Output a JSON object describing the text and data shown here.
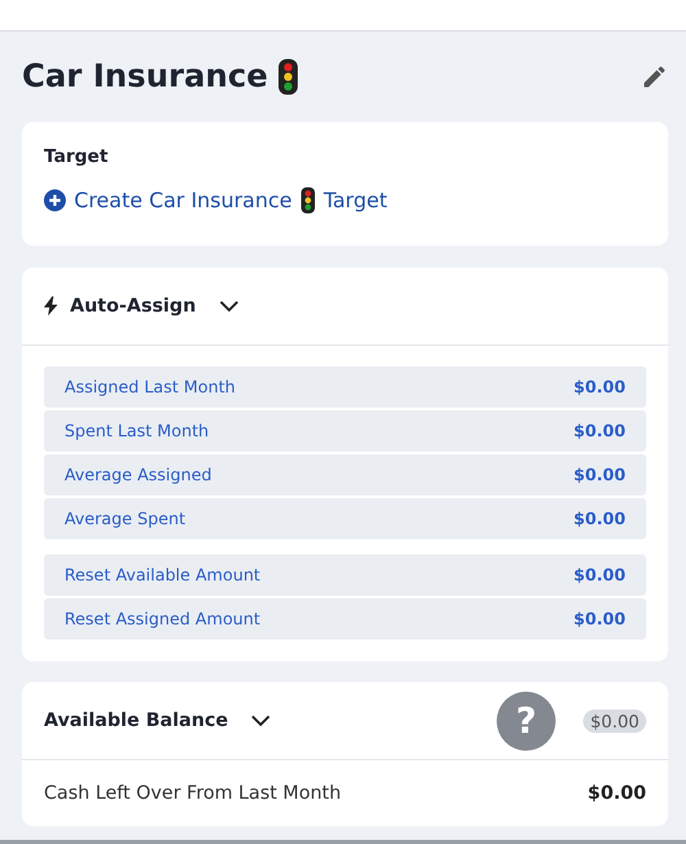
{
  "title": "Car Insurance",
  "target": {
    "heading": "Target",
    "link_before": "Create Car Insurance",
    "link_after": "Target"
  },
  "auto_assign": {
    "label": "Auto-Assign",
    "expanded": true,
    "groups": [
      [
        {
          "label": "Assigned Last Month",
          "amount": "$0.00"
        },
        {
          "label": "Spent Last Month",
          "amount": "$0.00"
        },
        {
          "label": "Average Assigned",
          "amount": "$0.00"
        },
        {
          "label": "Average Spent",
          "amount": "$0.00"
        }
      ],
      [
        {
          "label": "Reset Available Amount",
          "amount": "$0.00"
        },
        {
          "label": "Reset Assigned Amount",
          "amount": "$0.00"
        }
      ]
    ]
  },
  "available_balance": {
    "label": "Available Balance",
    "expanded": true,
    "amount": "$0.00",
    "rows": [
      {
        "label": "Cash Left Over From Last Month",
        "amount": "$0.00"
      }
    ]
  },
  "help_button": "?"
}
